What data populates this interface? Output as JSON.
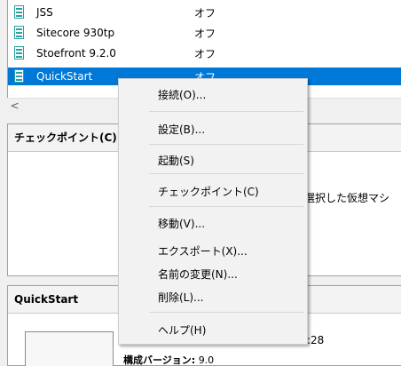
{
  "vm_list": [
    {
      "name": "JSS",
      "state": "オフ"
    },
    {
      "name": "Sitecore 930tp",
      "state": "オフ"
    },
    {
      "name": "Stoefront 9.2.0",
      "state": "オフ"
    },
    {
      "name": "QuickStart",
      "state": "オフ",
      "selected": true
    }
  ],
  "scrollbar": {
    "left_arrow": "<"
  },
  "checkpoint_panel": {
    "title": "チェックポイント(C)",
    "message_fragment": "選択した仮想マシ"
  },
  "quickstart_panel": {
    "title": "QuickStart",
    "time_fragment": ":28",
    "config_label": "構成バージョン:",
    "config_value": "9.0"
  },
  "context_menu": {
    "items": [
      {
        "label": "接続(O)..."
      },
      {
        "label": "設定(B)..."
      },
      {
        "label": "起動(S)"
      },
      {
        "label": "チェックポイント(C)"
      },
      {
        "label": "移動(V)..."
      },
      {
        "label": "エクスポート(X)..."
      },
      {
        "label": "名前の変更(N)..."
      },
      {
        "label": "削除(L)..."
      },
      {
        "label": "ヘルプ(H)"
      }
    ]
  }
}
